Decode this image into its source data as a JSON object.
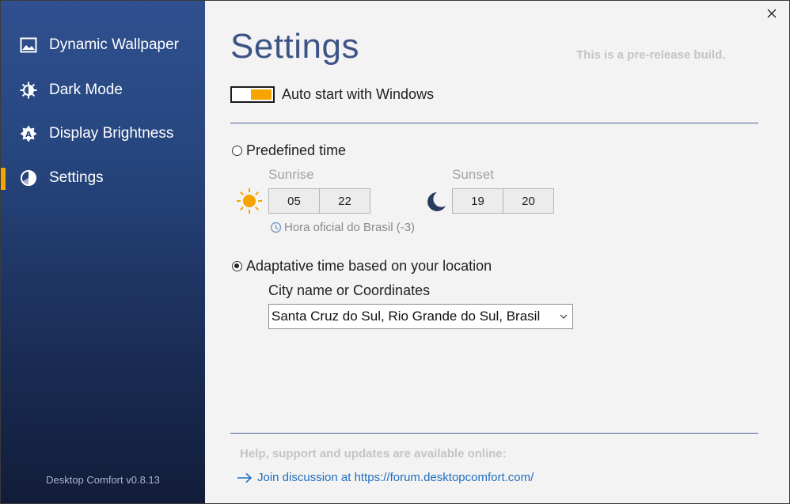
{
  "sidebar": {
    "items": [
      {
        "label": "Dynamic Wallpaper",
        "icon": "image-icon",
        "active": false
      },
      {
        "label": "Dark Mode",
        "icon": "sun-half-icon",
        "active": false
      },
      {
        "label": "Display Brightness",
        "icon": "brightness-icon",
        "active": false
      },
      {
        "label": "Settings",
        "icon": "half-circle-icon",
        "active": true
      }
    ],
    "version": "Desktop Comfort v0.8.13"
  },
  "main": {
    "title": "Settings",
    "prerelease": "This is a pre-release build.",
    "autostart": {
      "label": "Auto start with Windows",
      "enabled": true
    },
    "predefined": {
      "label": "Predefined time",
      "selected": false,
      "sunrise": {
        "label": "Sunrise",
        "hour": "05",
        "minute": "22"
      },
      "sunset": {
        "label": "Sunset",
        "hour": "19",
        "minute": "20"
      },
      "timezone": "Hora oficial do Brasil (-3)"
    },
    "adaptive": {
      "label": "Adaptative time based on your location",
      "selected": true,
      "city_label": "City name or Coordinates",
      "city_value": "Santa Cruz do Sul, Rio Grande do Sul, Brasil"
    },
    "help": {
      "label": "Help, support and updates are available online:",
      "link": "Join discussion at https://forum.desktopcomfort.com/"
    }
  },
  "colors": {
    "accent": "#f7a400",
    "title": "#3d5486",
    "link": "#1f6fbf",
    "sidebar_top": "#2f4f8f",
    "sidebar_bottom": "#111c38"
  }
}
